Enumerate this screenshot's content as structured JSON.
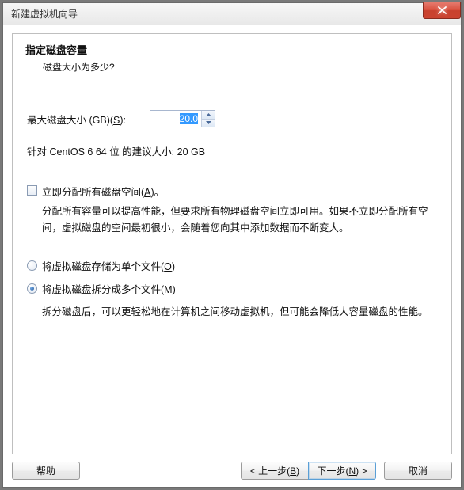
{
  "window": {
    "title": "新建虚拟机向导"
  },
  "header": {
    "heading": "指定磁盘容量",
    "sub": "磁盘大小为多少?"
  },
  "size": {
    "label_pre": "最大磁盘大小 (GB)(",
    "label_u": "S",
    "label_post": "):",
    "value": "20.0",
    "recommend": "针对 CentOS 6 64 位 的建议大小: 20 GB"
  },
  "alloc": {
    "label_pre": "立即分配所有磁盘空间(",
    "label_u": "A",
    "label_post": ")。",
    "checked": false,
    "desc": "分配所有容量可以提高性能，但要求所有物理磁盘空间立即可用。如果不立即分配所有空间，虚拟磁盘的空间最初很小，会随着您向其中添加数据而不断变大。"
  },
  "store": {
    "single_pre": "将虚拟磁盘存储为单个文件(",
    "single_u": "O",
    "single_post": ")",
    "split_pre": "将虚拟磁盘拆分成多个文件(",
    "split_u": "M",
    "split_post": ")",
    "selected": "split",
    "split_desc": "拆分磁盘后，可以更轻松地在计算机之间移动虚拟机，但可能会降低大容量磁盘的性能。"
  },
  "buttons": {
    "help": "帮助",
    "back_pre": "< 上一步(",
    "back_u": "B",
    "back_post": ")",
    "next_pre": "下一步(",
    "next_u": "N",
    "next_post": ") >",
    "cancel": "取消"
  }
}
